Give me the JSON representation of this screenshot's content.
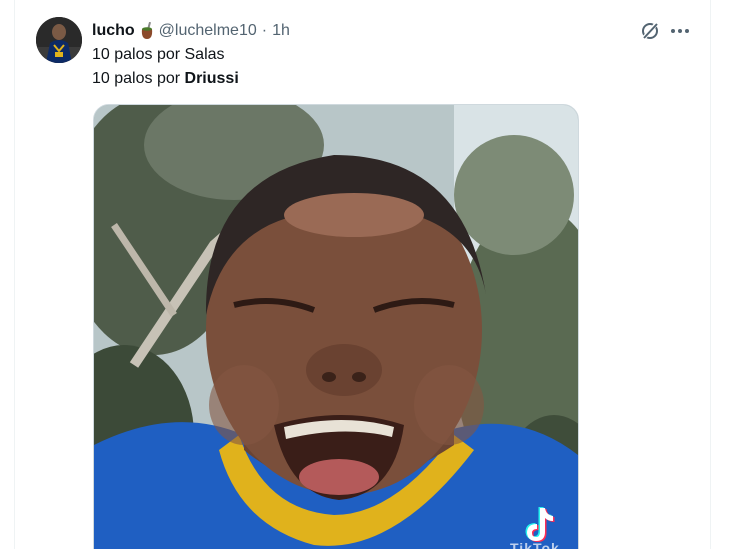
{
  "tweet": {
    "display_name": "lucho",
    "emoji_icon": "mate-icon",
    "handle": "@luchelme10",
    "separator": "·",
    "time": "1h",
    "line1": "10 palos por Salas",
    "line2_prefix": "10 palos por ",
    "line2_bold": "Driussi"
  },
  "actions": {
    "grok_icon": "grok-icon",
    "more_icon": "more-icon"
  },
  "media": {
    "watermark_icon": "tiktok-icon",
    "watermark_text": "TikTok"
  },
  "colors": {
    "text_primary": "#0f1419",
    "text_secondary": "#536471",
    "border": "#cfd9de",
    "jersey_blue": "#1f5fc2",
    "jersey_yellow": "#e0b21c"
  }
}
